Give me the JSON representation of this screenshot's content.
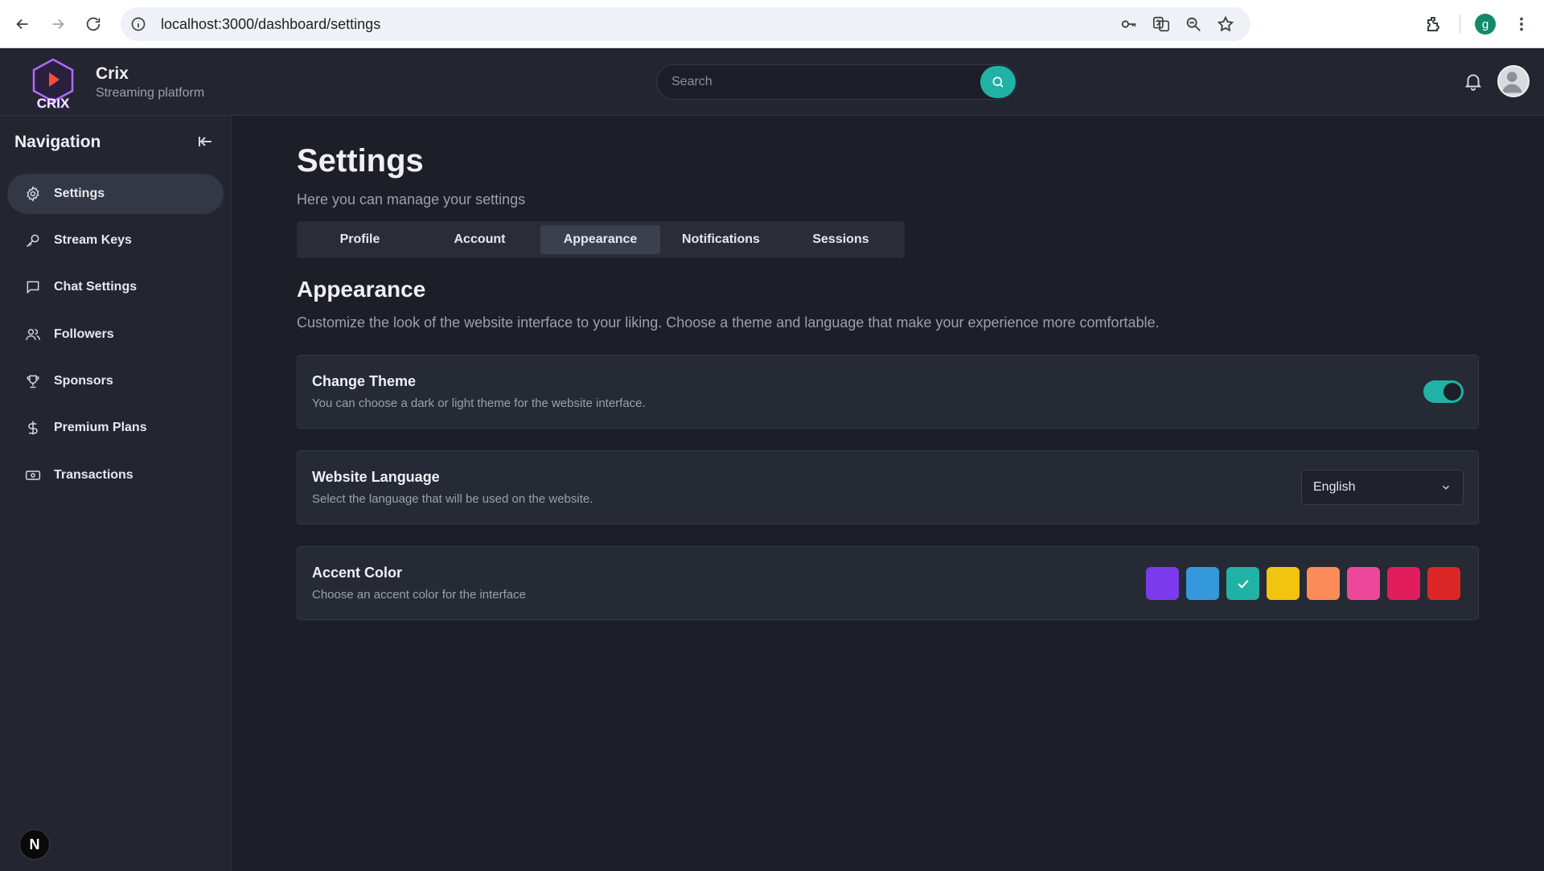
{
  "browser": {
    "url": "localhost:3000/dashboard/settings",
    "profile_initial": "g"
  },
  "header": {
    "brand_name": "Crix",
    "brand_sub": "Streaming platform",
    "logo_text": "CRIX",
    "search_placeholder": "Search"
  },
  "sidebar": {
    "title": "Navigation",
    "items": [
      {
        "label": "Settings",
        "icon": "gear-icon"
      },
      {
        "label": "Stream Keys",
        "icon": "key-icon"
      },
      {
        "label": "Chat Settings",
        "icon": "chat-icon"
      },
      {
        "label": "Followers",
        "icon": "users-icon"
      },
      {
        "label": "Sponsors",
        "icon": "trophy-icon"
      },
      {
        "label": "Premium Plans",
        "icon": "dollar-icon"
      },
      {
        "label": "Transactions",
        "icon": "banknote-icon"
      }
    ],
    "active_index": 0,
    "badge": "N"
  },
  "main": {
    "title": "Settings",
    "subtitle": "Here you can manage your settings",
    "tabs": [
      {
        "label": "Profile"
      },
      {
        "label": "Account"
      },
      {
        "label": "Appearance"
      },
      {
        "label": "Notifications"
      },
      {
        "label": "Sessions"
      }
    ],
    "active_tab": 2,
    "section_title": "Appearance",
    "section_desc": "Customize the look of the website interface to your liking. Choose a theme and language that make your experience more comfortable.",
    "theme": {
      "title": "Change Theme",
      "desc": "You can choose a dark or light theme for the website interface.",
      "on": true
    },
    "language": {
      "title": "Website Language",
      "desc": "Select the language that will be used on the website.",
      "selected": "English"
    },
    "accent": {
      "title": "Accent Color",
      "desc": "Choose an accent color for the interface",
      "colors": [
        "#7c3aed",
        "#3498db",
        "#20b2a5",
        "#f1c40f",
        "#fb8c5a",
        "#ec4899",
        "#e11d5e",
        "#dc2626"
      ],
      "selected_index": 2
    }
  }
}
